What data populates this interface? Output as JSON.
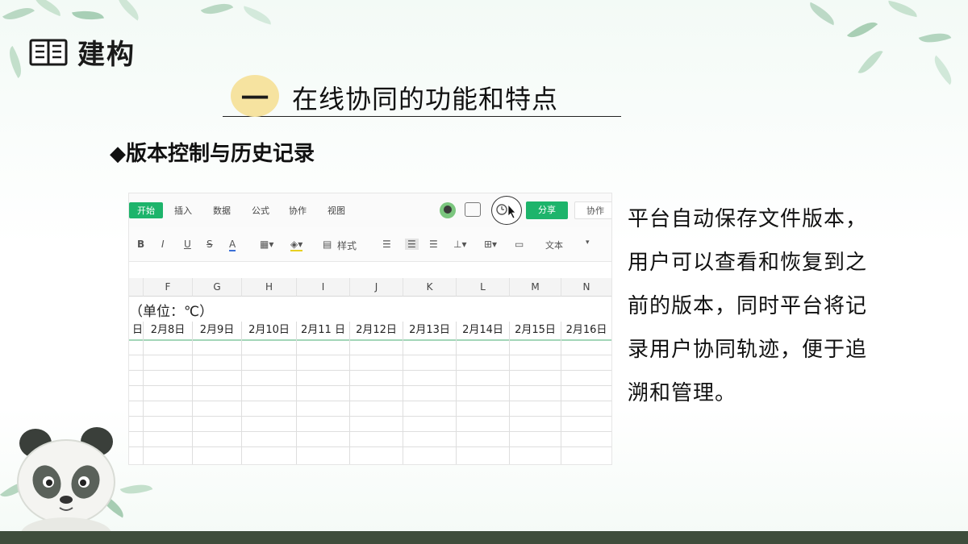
{
  "header": {
    "title": "建构",
    "book_icon": "open-book-icon"
  },
  "section": {
    "number": "一",
    "title": "在线协同的功能和特点"
  },
  "subtitle": "◆版本控制与历史记录",
  "spreadsheet": {
    "menu": {
      "active": "开始",
      "items": [
        "插入",
        "数据",
        "公式",
        "协作",
        "视图"
      ],
      "share": "分享",
      "collab": "协作"
    },
    "toolbar": {
      "bold": "B",
      "italic": "I",
      "underline": "U",
      "strike": "S",
      "font_color": "A",
      "style": "样式",
      "format": "文本"
    },
    "columns": [
      "F",
      "G",
      "H",
      "I",
      "J",
      "K",
      "L",
      "M",
      "N"
    ],
    "unit_label": "（单位：℃）",
    "row_partial_prefix": "日",
    "dates": [
      "2月8日",
      "2月9日",
      "2月10日",
      "2月11 日",
      "2月12日",
      "2月13日",
      "2月14日",
      "2月15日",
      "2月16日"
    ]
  },
  "description": [
    "平台自动保存文件版本，",
    "用户可以查看和恢复到之",
    "前的版本，同时平台将记",
    "录用户协同轨迹，便于追",
    "溯和管理。"
  ],
  "colors": {
    "accent_green": "#1db46b",
    "bar": "#3f4d3c",
    "badge": "#f6e3a0"
  }
}
